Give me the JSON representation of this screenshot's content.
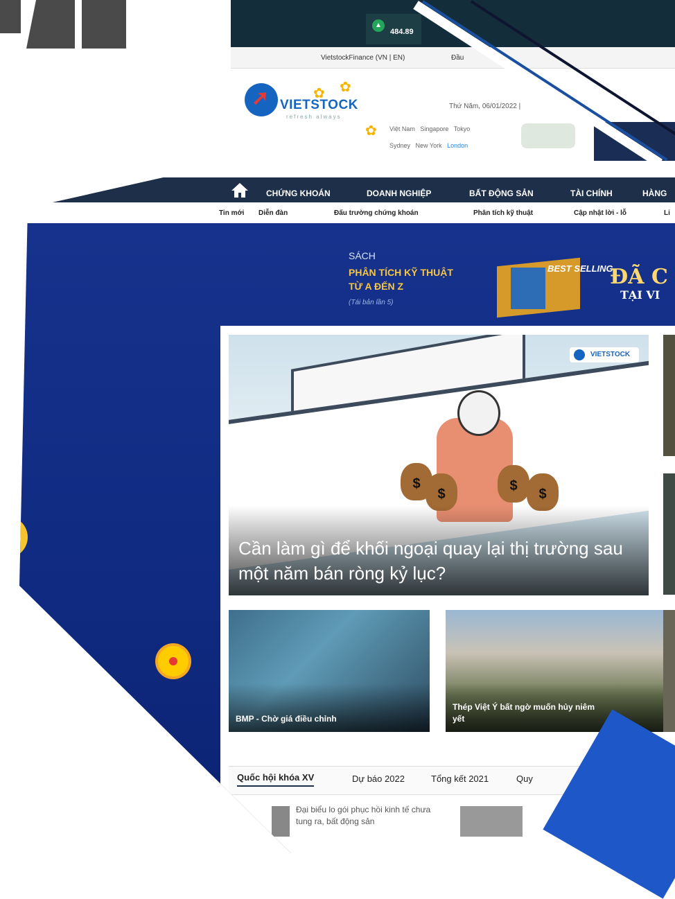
{
  "ticker": {
    "value": "484.89"
  },
  "topbar": {
    "links": [
      "VietstockFinance (VN | EN)",
      "Đầu"
    ]
  },
  "logo": {
    "brand": "VIETSTOCK",
    "tagline": "refresh always"
  },
  "header": {
    "date": "Thứ Năm, 06/01/2022 |",
    "cities_row1": [
      "Việt Nam",
      "Singapore",
      "Tokyo"
    ],
    "cities_row2": [
      "Sydney",
      "New York",
      "London"
    ]
  },
  "nav": {
    "items": [
      "CHỨNG KHOÁN",
      "DOANH NGHIỆP",
      "BẤT ĐỘNG SẢN",
      "TÀI CHÍNH",
      "HÀNG"
    ]
  },
  "subnav": {
    "items": [
      "Tin mới",
      "Diễn đàn",
      "Đấu trường chứng khoán",
      "Phân tích kỹ thuật",
      "Cập nhật lời - lỗ",
      "Li"
    ]
  },
  "banner": {
    "line0": "SÁCH",
    "line1": "PHÂN TÍCH KỸ THUẬT",
    "line2": "TỪ A ĐẾN Z",
    "line3": "(Tái bản lần 5)",
    "badge": "BEST SELLING",
    "big1": "ĐÃ C",
    "big2": "TẠI VI"
  },
  "hero": {
    "title": "Cần làm gì để khối ngoại quay lại thị trường sau một năm bán ròng kỷ lục?",
    "watermark": "VIETSTOCK"
  },
  "cards": [
    {
      "title": "BMP - Chờ giá điều chỉnh"
    },
    {
      "title": "Thép Việt Ý bất ngờ muốn hủy niêm yết"
    }
  ],
  "tabs": [
    "Quốc hội khóa XV",
    "Dự báo 2022",
    "Tổng kết 2021",
    "Quy"
  ],
  "news": {
    "snippet": "Đại biểu lo gói phục hồi kinh tế chưa tung ra, bất động sản"
  },
  "colors": {
    "nav": "#1e2f49",
    "banner": "#16328c",
    "brand": "#1565c0",
    "accent": "#f6c544"
  }
}
